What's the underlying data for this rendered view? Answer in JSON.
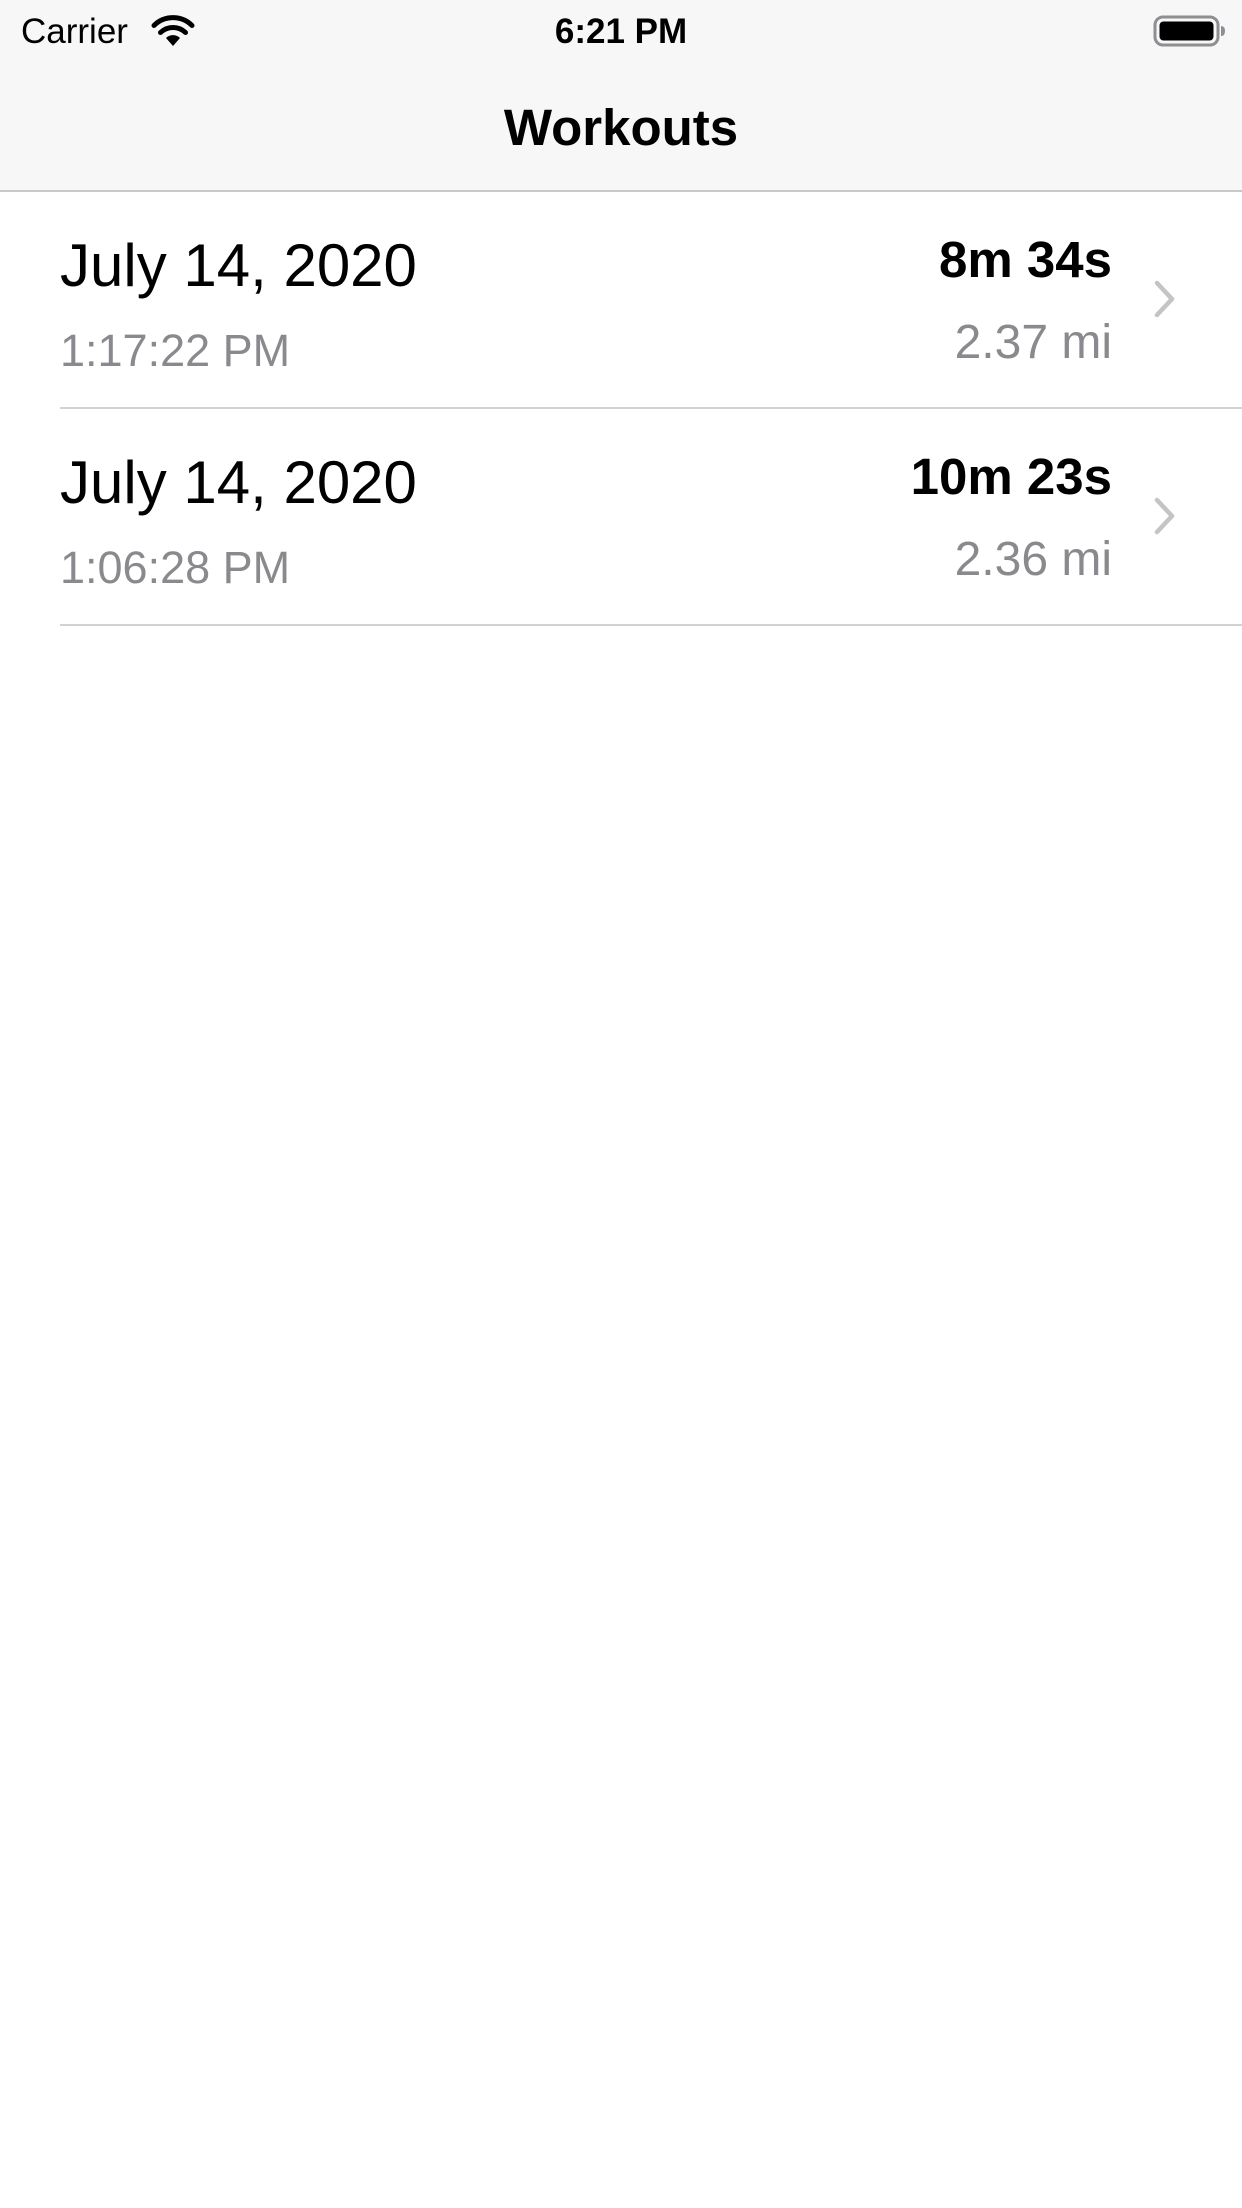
{
  "status_bar": {
    "carrier": "Carrier",
    "time": "6:21 PM",
    "wifi_icon": "wifi-icon",
    "battery_icon": "battery-icon"
  },
  "nav": {
    "title": "Workouts"
  },
  "workouts": [
    {
      "date": "July 14, 2020",
      "time": "1:17:22 PM",
      "duration": "8m 34s",
      "distance": "2.37 mi",
      "icon": "chevron-right-icon"
    },
    {
      "date": "July 14, 2020",
      "time": "1:06:28 PM",
      "duration": "10m 23s",
      "distance": "2.36 mi",
      "icon": "chevron-right-icon"
    }
  ],
  "colors": {
    "secondary_text": "#8a8a8e",
    "separator": "#d1d1d6",
    "bar_background": "#f7f7f7",
    "chevron": "#c4c4c7"
  }
}
